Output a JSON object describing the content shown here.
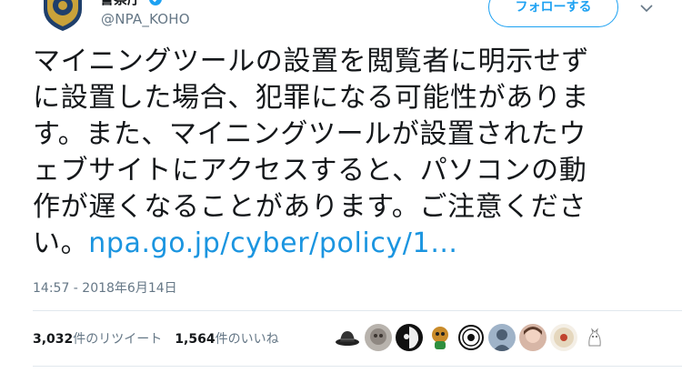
{
  "account": {
    "display_name": "警察庁",
    "handle": "@NPA_KOHO"
  },
  "follow_button": {
    "label": "フォローする"
  },
  "tweet": {
    "lines": [
      "マイニングツールの設置を閲覧者に明示せず",
      "に設置した場合、犯罪になる可能性がありま",
      "す。また、マイニングツールが設置されたウ",
      "ェブサイトにアクセスすると、パソコンの動",
      "作が遅くなることがあります。ご注意くださ"
    ],
    "last_line_prefix": "い。",
    "link": "npa.go.jp/cyber/policy/1…"
  },
  "timestamp": "14:57 - 2018年6月14日",
  "stats": {
    "retweets_count": "3,032",
    "retweets_label": "件のリツイート",
    "likes_count": "1,564",
    "likes_label": "件のいいね"
  },
  "colors": {
    "accent": "#1da1f2",
    "link": "#1b95e0",
    "secondary_text": "#657786"
  }
}
